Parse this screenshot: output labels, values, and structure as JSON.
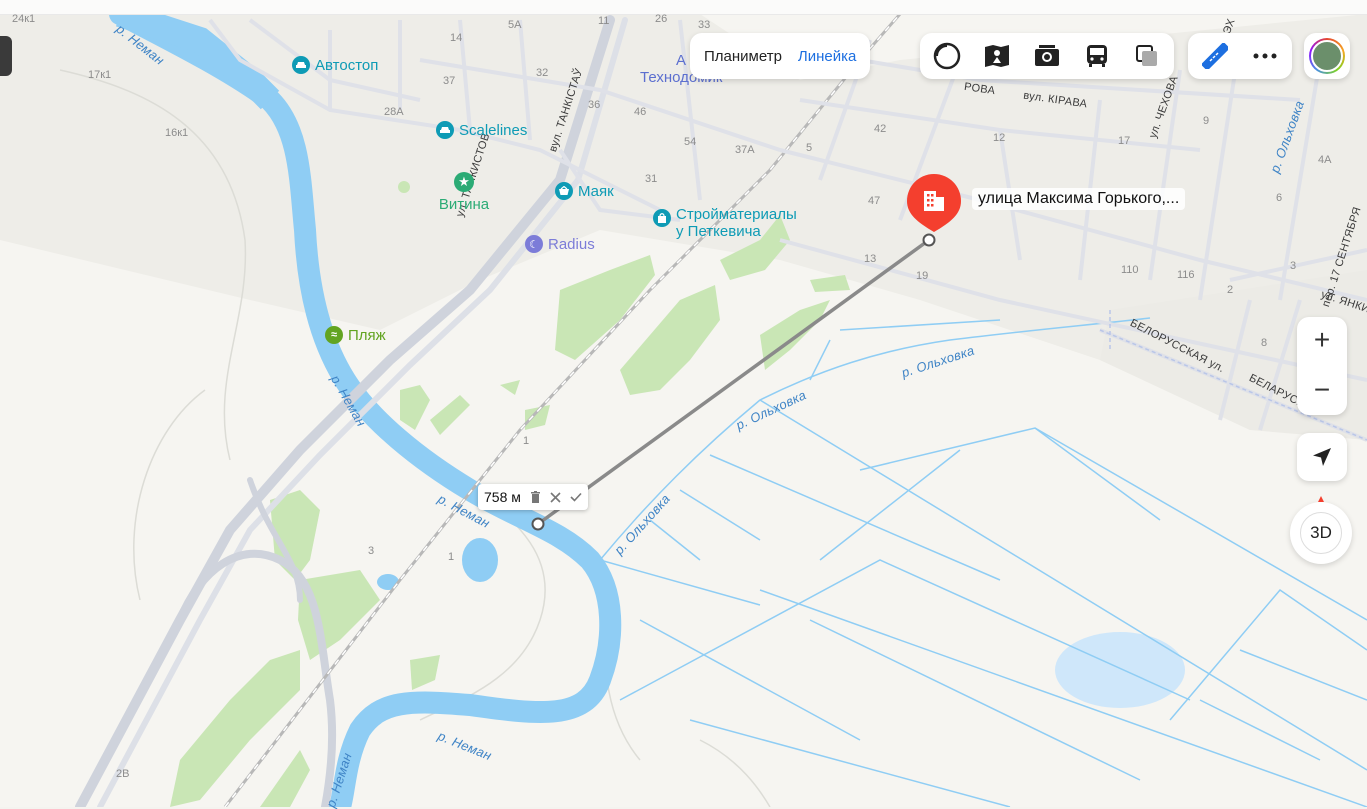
{
  "toolbar": {
    "tab_planimeter": "Планиметр",
    "tab_ruler": "Линейка",
    "active_tab": "Линейка",
    "layer_icons": [
      "layers-icon",
      "panorama-icon",
      "photo-icon",
      "transit-icon",
      "map-style-icon"
    ],
    "ruler_icon": "ruler-icon",
    "more_icon": "more-icon"
  },
  "controls": {
    "zoom_in": "+",
    "zoom_out": "−",
    "locate_icon": "locate-icon",
    "mode_3d": "3D"
  },
  "measurement": {
    "distance": "758 м",
    "delete_icon": "trash-icon",
    "close_icon": "close-icon",
    "confirm_icon": "check-icon"
  },
  "marker": {
    "title": "улица Максима Горького,...",
    "icon": "building-icon",
    "color": "#f43f2e"
  },
  "pois": {
    "avtostop": "Автостоп",
    "scalelines": "Scalelines",
    "vitina": "Витина",
    "mayak": "Маяк",
    "stroy_line1": "Стройматериалы",
    "stroy_line2": "у Петкевича",
    "radius": "Radius",
    "plyazh": "Пляж",
    "tekhnodom_line1": "А",
    "tekhnodom_line2": "Технодомик"
  },
  "streets": {
    "tankistov": "ул. ТАНКИСТОВ",
    "tankistau": "вул. ТАНКІСТАЎ",
    "kirava": "вул. КІРАВА",
    "rova": "РОВА",
    "chekhova": "ул. ЧЕХОВА",
    "olkhovka_road": "р. Ольховка",
    "sentyabrya": "пер. 17 СЕНТЯБРЯ",
    "yanki": "ул. ЯНКИ",
    "belorusskaya": "БЕЛОРУССКАЯ ул.",
    "belarus": "БЕЛАРУСК",
    "ekh": "ЭХ"
  },
  "rivers": {
    "neman1": "р. Неман",
    "neman2": "р. Неман",
    "neman3": "р. Неман",
    "neman4": "р. Неман",
    "neman5": "р. Неман",
    "olkhovka1": "р. Ольховка",
    "olkhovka2": "р. Ольховка",
    "olkhovka3": "р. Ольховка"
  },
  "house_numbers": {
    "n24k1": "24к1",
    "n17k1": "17к1",
    "n16k1": "16к1",
    "n5a": "5А",
    "n11": "11",
    "n14": "14",
    "n37": "37",
    "n32": "32",
    "n28a": "28А",
    "n36": "36",
    "n26": "26",
    "n33": "33",
    "n46": "46",
    "n54": "54",
    "n37a": "37А",
    "n31": "31",
    "n5": "5",
    "n42": "42",
    "n12": "12",
    "n17": "17",
    "n9": "9",
    "n47": "47",
    "n13": "13",
    "n19": "19",
    "n110": "110",
    "n116": "116",
    "n4a": "4А",
    "n6": "6",
    "n3": "3",
    "n2": "2",
    "n8": "8",
    "n1a": "1",
    "n1b": "1",
    "n3b": "3",
    "n2b": "2В"
  },
  "colors": {
    "water": "#8fcdf4",
    "park": "#c9e6b5",
    "active_blue": "#1d6fe0",
    "poi_teal": "#0e9bb5",
    "poi_green": "#2bab75",
    "poi_olive": "#62a421",
    "poi_purple": "#7c7cd8"
  }
}
